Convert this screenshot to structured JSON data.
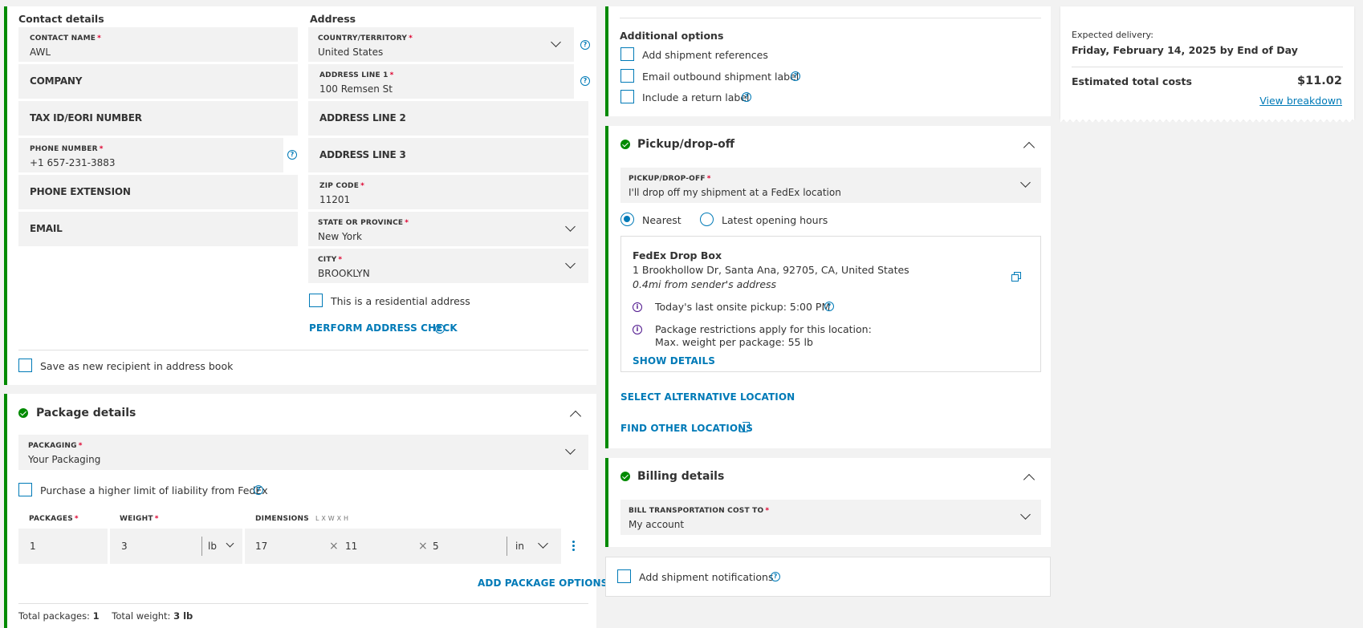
{
  "contact": {
    "heading": "Contact details",
    "name_label": "CONTACT NAME",
    "name_value": "AWL",
    "company_label": "COMPANY",
    "taxid_label": "TAX ID/EORI NUMBER",
    "phone_label": "PHONE NUMBER",
    "phone_value": "+1 657-231-3883",
    "ext_label": "PHONE EXTENSION",
    "email_label": "EMAIL",
    "save_label": "Save as new recipient in address book"
  },
  "address": {
    "heading": "Address",
    "country_label": "COUNTRY/TERRITORY",
    "country_value": "United States",
    "line1_label": "ADDRESS LINE 1",
    "line1_value": "100 Remsen St",
    "line2_label": "ADDRESS LINE 2",
    "line3_label": "ADDRESS LINE 3",
    "zip_label": "ZIP CODE",
    "zip_value": "11201",
    "state_label": "STATE OR PROVINCE",
    "state_value": "New York",
    "city_label": "CITY",
    "city_value": "BROOKLYN",
    "residential_label": "This is a residential address",
    "check_label": "PERFORM ADDRESS CHECK"
  },
  "package": {
    "title": "Package details",
    "packaging_label": "PACKAGING",
    "packaging_value": "Your Packaging",
    "liability_label": "Purchase a higher limit of liability from FedEx",
    "packages_label": "PACKAGES",
    "weight_label": "WEIGHT",
    "dimensions_label": "DIMENSIONS",
    "dimensions_hint": "L x W x H",
    "packages_value": "1",
    "weight_value": "3",
    "weight_unit": "lb",
    "dim_l": "17",
    "dim_w": "11",
    "dim_h": "5",
    "dim_unit": "in",
    "times": "×",
    "add_options": "ADD PACKAGE OPTIONS",
    "total_packages_label": "Total packages:",
    "total_packages_value": "1",
    "total_weight_label": "Total weight:",
    "total_weight_value": "3 lb"
  },
  "additional": {
    "heading": "Additional options",
    "references": "Add shipment references",
    "email_label": "Email outbound shipment label",
    "return_label": "Include a return label"
  },
  "pickup": {
    "title": "Pickup/drop-off",
    "field_label": "PICKUP/DROP-OFF",
    "field_value": "I'll drop off my shipment at a FedEx location",
    "nearest": "Nearest",
    "latest": "Latest opening hours",
    "loc_name": "FedEx Drop Box",
    "loc_address": "1 Brookhollow Dr, Santa Ana, 92705, CA, United States",
    "loc_distance": "0.4mi from sender's address",
    "last_pickup": "Today's last onsite pickup: 5:00 PM",
    "restrictions_1": "Package restrictions apply for this location:",
    "restrictions_2": "Max. weight per package: 55 lb",
    "show_details": "SHOW DETAILS",
    "select_alt": "SELECT ALTERNATIVE LOCATION",
    "find_other": "FIND OTHER LOCATIONS"
  },
  "billing": {
    "title": "Billing details",
    "field_label": "BILL TRANSPORTATION COST TO",
    "field_value": "My account"
  },
  "notifications": {
    "label": "Add shipment notifications"
  },
  "summary": {
    "expected_label": "Expected delivery:",
    "expected_value": "Friday, February 14, 2025 by End of Day",
    "total_label": "Estimated total costs",
    "total_value": "$11.02",
    "breakdown": "View breakdown"
  },
  "icons": {
    "help": "?",
    "info": "i"
  },
  "colors": {
    "accent_green": "#008a00",
    "link_blue": "#007ab7",
    "required_red": "#de002e",
    "info_purple": "#4d148c"
  }
}
